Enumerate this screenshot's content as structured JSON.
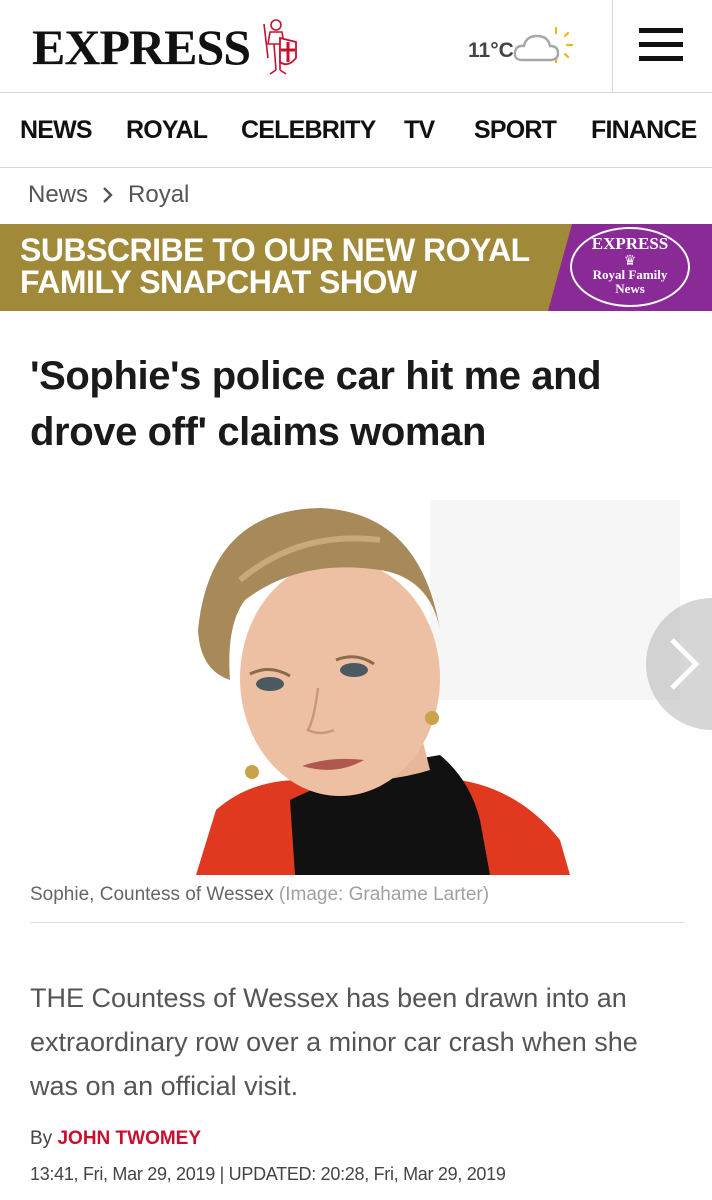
{
  "header": {
    "logo_text": "EXPRESS",
    "crest_icon": "crusader-knight-crest-icon",
    "weather": {
      "temperature": "11°C",
      "icon": "partly-cloudy-icon"
    },
    "menu_icon": "hamburger-menu-icon"
  },
  "nav": {
    "items": [
      {
        "label": "NEWS"
      },
      {
        "label": "ROYAL"
      },
      {
        "label": "CELEBRITY"
      },
      {
        "label": "TV"
      },
      {
        "label": "SPORT"
      },
      {
        "label": "FINANCE"
      }
    ]
  },
  "breadcrumb": {
    "items": [
      "News",
      "Royal"
    ],
    "separator_icon": "chevron-right-icon"
  },
  "banner": {
    "text": "SUBSCRIBE TO OUR NEW ROYAL FAMILY SNAPCHAT SHOW",
    "badge_brand": "EXPRESS",
    "badge_line1": "Royal Family",
    "badge_line2": "News",
    "colors": {
      "gold": "#a08a3a",
      "purple": "#8a2a96"
    }
  },
  "article": {
    "headline": "'Sophie's police car hit me and drove off' claims woman",
    "image_caption": "Sophie, Countess of Wessex",
    "image_credit": "(Image: Grahame Larter)",
    "intro": "THE Countess of Wessex has been drawn into an extraordinary row over a minor car crash when she was on an official visit.",
    "byline_prefix": "By",
    "author": "JOHN TWOMEY",
    "timestamp": "13:41, Fri, Mar 29, 2019 | UPDATED: 20:28, Fri, Mar 29, 2019",
    "accent_color": "#c8102e"
  }
}
